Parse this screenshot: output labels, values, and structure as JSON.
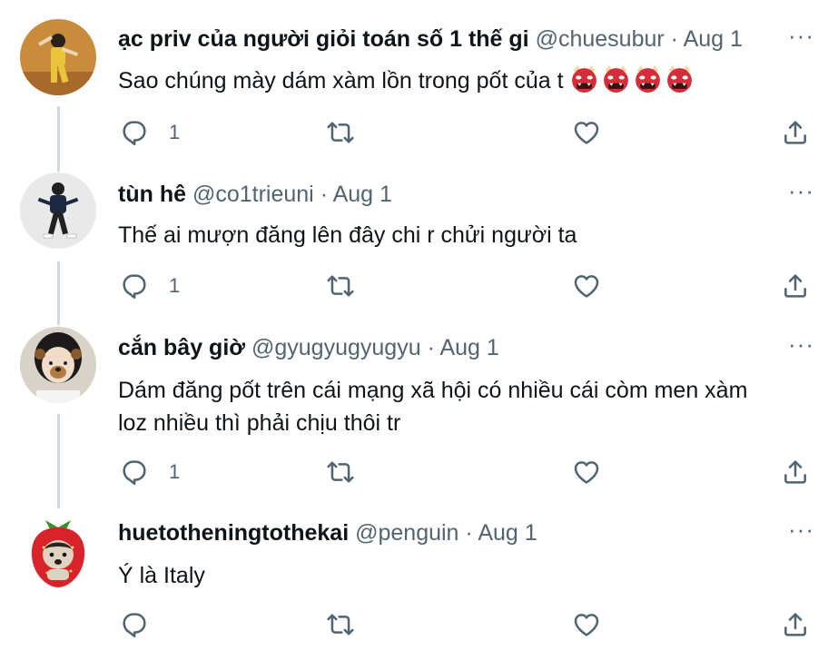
{
  "tweets": [
    {
      "name": "ạc priv của người giỏi toán số 1 thế gi",
      "handle": "@chuesubur",
      "sep": "·",
      "date": "Aug 1",
      "text": "Sao chúng mày dám xàm lồn trong pốt của t",
      "emoji": "👹👹👹👹",
      "reply_count": "1",
      "more": "···"
    },
    {
      "name": "tùn hê",
      "handle": "@co1trieuni",
      "sep": "·",
      "date": "Aug 1",
      "text": "Thế ai mượn đăng lên đây chi r chửi người ta",
      "reply_count": "1",
      "more": "···"
    },
    {
      "name": "cắn bây giờ",
      "handle": "@gyugyugyugyu",
      "sep": "·",
      "date": "Aug 1",
      "text_line1": "Dám đăng pốt trên cái mạng xã hội có nhiều cái còm men xàm",
      "text_line2": "loz nhiều thì phải chịu thôi tr",
      "reply_count": "1",
      "more": "···"
    },
    {
      "name": "huetotheningtothekai",
      "handle": "@penguin",
      "sep": "·",
      "date": "Aug 1",
      "text": "Ý là Italy",
      "reply_count": "",
      "more": "···"
    }
  ],
  "colors": {
    "text": "#0f1419",
    "secondary": "#536471",
    "thread": "#cfd9de"
  },
  "icons": [
    "reply-icon",
    "retweet-icon",
    "like-icon",
    "share-icon",
    "more-icon"
  ]
}
